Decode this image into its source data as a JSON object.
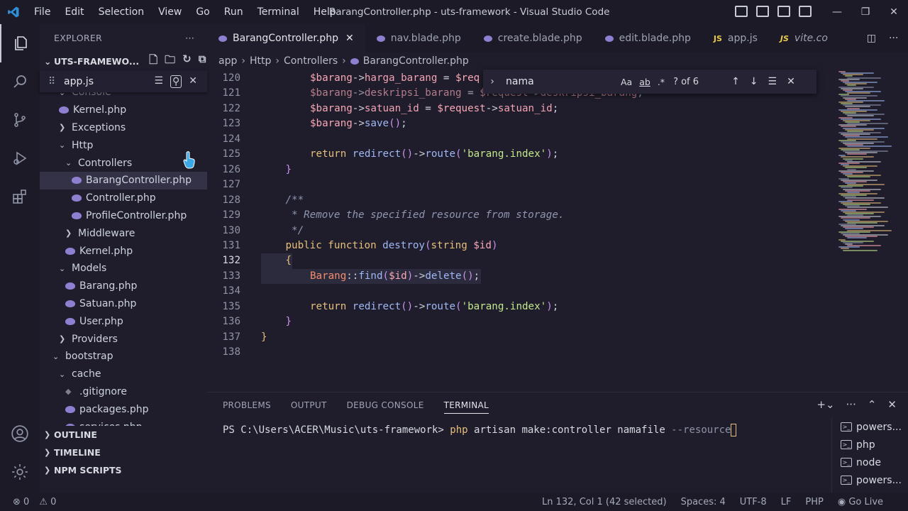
{
  "window": {
    "title": "BarangController.php - uts-framework - Visual Studio Code",
    "menu": [
      "File",
      "Edit",
      "Selection",
      "View",
      "Go",
      "Run",
      "Terminal",
      "Help"
    ],
    "controls": [
      "—",
      "❐",
      "✕"
    ]
  },
  "sidebar": {
    "header": "EXPLORER",
    "more": "···",
    "project": "UTS-FRAMEWO...",
    "find_value": "app.js",
    "tree": [
      {
        "label": "Console",
        "kind": "folder-open",
        "indent": 1
      },
      {
        "label": "Kernel.php",
        "kind": "php",
        "indent": 1
      },
      {
        "label": "Exceptions",
        "kind": "folder-closed",
        "indent": 1
      },
      {
        "label": "Http",
        "kind": "folder-open",
        "indent": 1
      },
      {
        "label": "Controllers",
        "kind": "folder-open",
        "indent": 2
      },
      {
        "label": "BarangController.php",
        "kind": "php",
        "indent": 3,
        "selected": true
      },
      {
        "label": "Controller.php",
        "kind": "php",
        "indent": 3
      },
      {
        "label": "ProfileController.php",
        "kind": "php",
        "indent": 3
      },
      {
        "label": "Middleware",
        "kind": "folder-closed",
        "indent": 2
      },
      {
        "label": "Kernel.php",
        "kind": "php",
        "indent": 2
      },
      {
        "label": "Models",
        "kind": "folder-open",
        "indent": 1
      },
      {
        "label": "Barang.php",
        "kind": "php",
        "indent": 2
      },
      {
        "label": "Satuan.php",
        "kind": "php",
        "indent": 2
      },
      {
        "label": "User.php",
        "kind": "php",
        "indent": 2
      },
      {
        "label": "Providers",
        "kind": "folder-closed",
        "indent": 1
      },
      {
        "label": "bootstrap",
        "kind": "folder-open",
        "indent": 0
      },
      {
        "label": "cache",
        "kind": "folder-open",
        "indent": 1
      },
      {
        "label": ".gitignore",
        "kind": "git",
        "indent": 2
      },
      {
        "label": "packages.php",
        "kind": "php",
        "indent": 2
      },
      {
        "label": "services.php",
        "kind": "php",
        "indent": 2
      }
    ],
    "sections": [
      "OUTLINE",
      "TIMELINE",
      "NPM SCRIPTS"
    ]
  },
  "tabs": [
    {
      "label": "BarangController.php",
      "type": "php",
      "active": true,
      "close": "✕"
    },
    {
      "label": "nav.blade.php",
      "type": "php"
    },
    {
      "label": "create.blade.php",
      "type": "php"
    },
    {
      "label": "edit.blade.php",
      "type": "php"
    },
    {
      "label": "app.js",
      "type": "js"
    },
    {
      "label": "vite.co",
      "type": "js",
      "italic": true
    }
  ],
  "breadcrumb": [
    "app",
    "Http",
    "Controllers",
    "BarangController.php"
  ],
  "find": {
    "value": "nama",
    "match_case": "Aa",
    "whole_word": "ab",
    "regex": ".*",
    "count": "? of 6"
  },
  "editor": {
    "current_line": 132,
    "lines": [
      {
        "n": "120",
        "html": "<span class='v'>$barang</span><span class='op'>-></span><span class='pr'>harga_barang</span><span class='op'> = </span><span class='v'>$req</span>"
      },
      {
        "n": "121",
        "html": "<span class='v'>$barang</span><span class='op'>-></span><span class='pr'>deskripsi_barang</span><span class='op'> = </span><span class='v'>$request</span><span class='op'>-></span><span class='pr'>deskripsi_barang</span><span class='pl'>;</span>"
      },
      {
        "n": "122",
        "html": "<span class='v'>$barang</span><span class='op'>-></span><span class='pr'>satuan_id</span><span class='op'> = </span><span class='v'>$request</span><span class='op'>-></span><span class='pr'>satuan_id</span><span class='pl'>;</span>"
      },
      {
        "n": "123",
        "html": "<span class='v'>$barang</span><span class='op'>-></span><span class='fn'>save</span><span class='pn'>()</span><span class='pl'>;</span>"
      },
      {
        "n": "124",
        "html": ""
      },
      {
        "n": "125",
        "html": "<span class='kw'>return</span> <span class='fn'>redirect</span><span class='pn'>()</span><span class='op'>-></span><span class='fn'>route</span><span class='pn'>(</span><span class='st'>'barang.index'</span><span class='pn'>)</span><span class='pl'>;</span>"
      },
      {
        "n": "126",
        "html": "<span class='pn'>}</span>"
      },
      {
        "n": "127",
        "html": ""
      },
      {
        "n": "128",
        "html": "<span class='cm'>/**</span>"
      },
      {
        "n": "129",
        "html": "<span class='cm'> * Remove the specified resource from storage.</span>"
      },
      {
        "n": "130",
        "html": "<span class='cm'> */</span>"
      },
      {
        "n": "131",
        "html": "<span class='kw'>public function</span> <span class='fn'>destroy</span><span class='pn'>(</span><span class='kw'>string</span> <span class='v'>$id</span><span class='pn'>)</span>"
      },
      {
        "n": "132",
        "html": "<span class='kw'>{</span>"
      },
      {
        "n": "133",
        "html": "<span class='cls'>Barang</span><span class='op'>::</span><span class='fn'>find</span><span class='pn'>(</span><span class='v'>$id</span><span class='pn'>)</span><span class='op'>-></span><span class='fn'>delete</span><span class='pn'>()</span><span class='pl'>;</span>"
      },
      {
        "n": "134",
        "html": ""
      },
      {
        "n": "135",
        "html": "<span class='kw'>return</span> <span class='fn'>redirect</span><span class='pn'>()</span><span class='op'>-></span><span class='fn'>route</span><span class='pn'>(</span><span class='st'>'barang.index'</span><span class='pn'>)</span><span class='pl'>;</span>"
      },
      {
        "n": "136",
        "html": "<span class='pn'>}</span>"
      },
      {
        "n": "137",
        "html": "<span class='kw'>}</span>"
      },
      {
        "n": "138",
        "html": ""
      }
    ]
  },
  "panel": {
    "tabs": [
      "PROBLEMS",
      "OUTPUT",
      "DEBUG CONSOLE",
      "TERMINAL"
    ],
    "active_tab": "TERMINAL",
    "prompt": "PS C:\\Users\\ACER\\Music\\uts-framework> ",
    "command": "php",
    "command_rest": " artisan make:controller namafile ",
    "command_flag": "--resource",
    "terminals": [
      "powers...",
      "php",
      "node",
      "powers..."
    ]
  },
  "status": {
    "errors": "0",
    "warnings": "0",
    "position": "Ln 132, Col 1 (42 selected)",
    "spaces": "Spaces: 4",
    "encoding": "UTF-8",
    "eol": "LF",
    "language": "PHP",
    "golive": "Go Live"
  },
  "colors": {
    "accent": "#2f8fd8",
    "background": "#1f1d2b",
    "php_icon": "#8f7fd1"
  }
}
